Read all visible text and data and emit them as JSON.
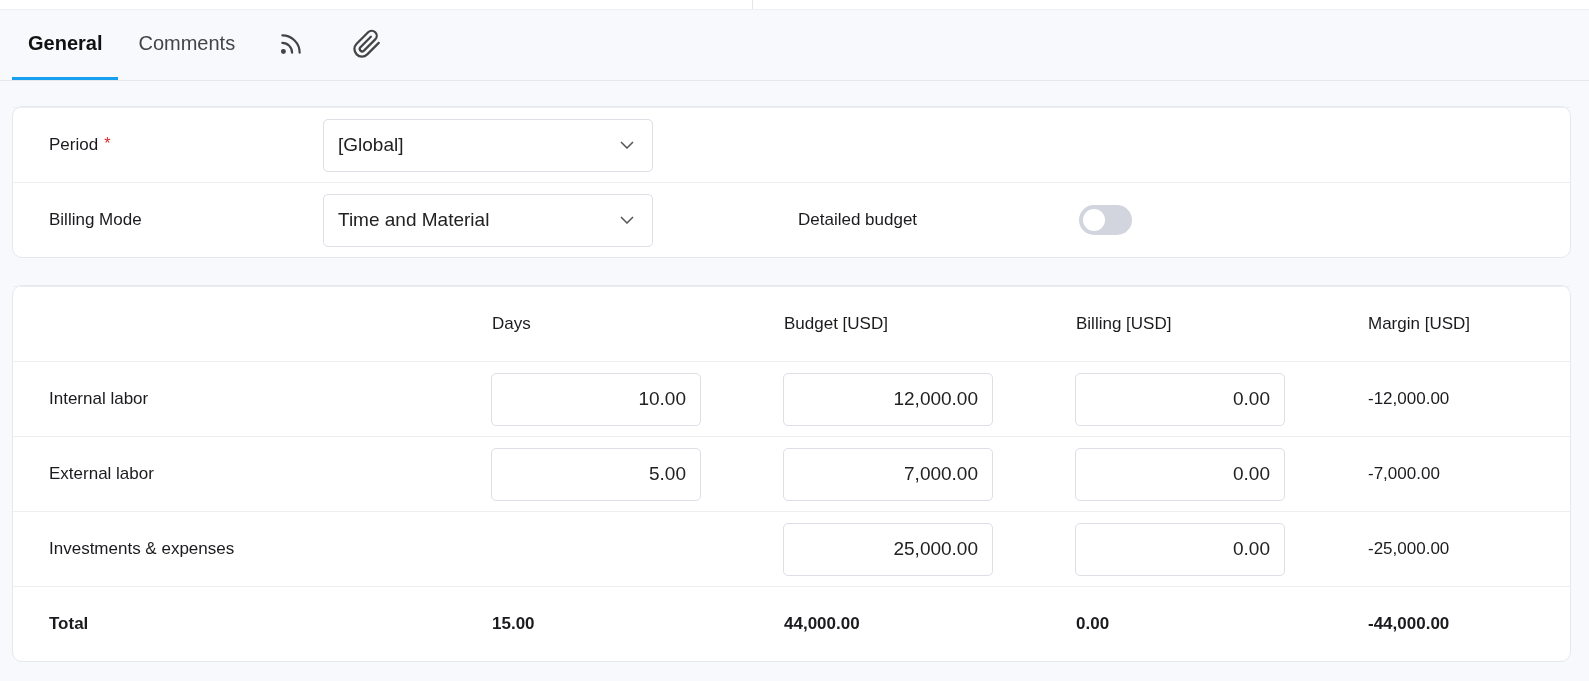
{
  "tabs": [
    {
      "kind": "text",
      "label": "General",
      "selected": true
    },
    {
      "kind": "text",
      "label": "Comments",
      "selected": false
    },
    {
      "kind": "feed",
      "selected": false
    },
    {
      "kind": "attachment",
      "selected": false
    }
  ],
  "form": {
    "fields": [
      {
        "kind": "select",
        "label": "Period",
        "required_mark": "*",
        "value": "[Global]"
      },
      {
        "kind": "select",
        "label": "Billing Mode",
        "value": "Time and Material",
        "toggle": {
          "label": "Detailed budget",
          "on": false
        }
      }
    ]
  },
  "budget_table": {
    "columns": [
      "Days",
      "Budget [USD]",
      "Billing [USD]",
      "Margin [USD]"
    ],
    "rows": [
      {
        "label": "Internal labor",
        "total": false,
        "cells": [
          {
            "kind": "input",
            "value": "10.00"
          },
          {
            "kind": "input",
            "value": "12,000.00"
          },
          {
            "kind": "input",
            "value": "0.00"
          },
          {
            "kind": "text",
            "value": "-12,000.00"
          }
        ]
      },
      {
        "label": "External labor",
        "total": false,
        "cells": [
          {
            "kind": "input",
            "value": "5.00"
          },
          {
            "kind": "input",
            "value": "7,000.00"
          },
          {
            "kind": "input",
            "value": "0.00"
          },
          {
            "kind": "text",
            "value": "-7,000.00"
          }
        ]
      },
      {
        "label": "Investments & expenses",
        "total": false,
        "cells": [
          {
            "kind": "empty"
          },
          {
            "kind": "input",
            "value": "25,000.00"
          },
          {
            "kind": "input",
            "value": "0.00"
          },
          {
            "kind": "text",
            "value": "-25,000.00"
          }
        ]
      },
      {
        "label": "Total",
        "total": true,
        "cells": [
          {
            "kind": "text",
            "value": "15.00"
          },
          {
            "kind": "text",
            "value": "44,000.00"
          },
          {
            "kind": "text",
            "value": "0.00"
          },
          {
            "kind": "text",
            "value": "-44,000.00"
          }
        ]
      }
    ]
  }
}
